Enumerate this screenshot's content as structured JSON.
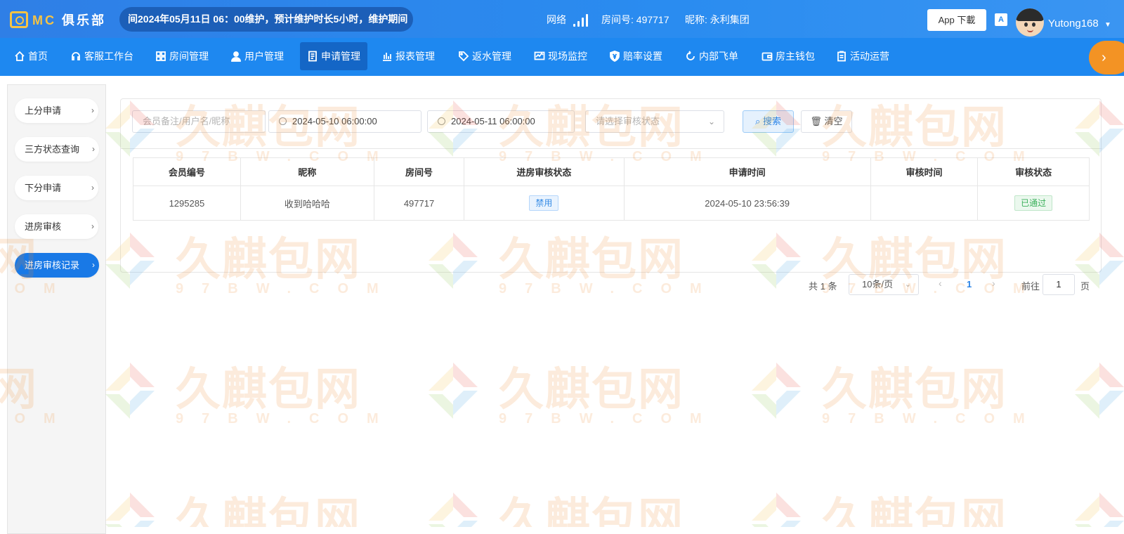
{
  "header": {
    "brand_prefix": "MC",
    "brand_cn": "俱乐部",
    "announcement": "间2024年05月11日 06：00维护，预计维护时长5小时，维护期间",
    "network_label": "网络",
    "room_label": "房间号: 497717",
    "nickname_label": "昵称: 永利集团",
    "app_download": "App 下載",
    "lang_icon": "translate-icon",
    "username": "Yutong168"
  },
  "nav": {
    "items": [
      {
        "label": "首页",
        "icon": "home-icon"
      },
      {
        "label": "客服工作台",
        "icon": "headset-icon"
      },
      {
        "label": "房间管理",
        "icon": "grid-icon"
      },
      {
        "label": "用户管理",
        "icon": "user-icon"
      },
      {
        "label": "申请管理",
        "icon": "form-icon"
      },
      {
        "label": "报表管理",
        "icon": "bar-chart-icon"
      },
      {
        "label": "返水管理",
        "icon": "tag-icon"
      },
      {
        "label": "现场监控",
        "icon": "monitor-icon"
      },
      {
        "label": "赔率设置",
        "icon": "yen-shield-icon"
      },
      {
        "label": "内部飞单",
        "icon": "cycle-icon"
      },
      {
        "label": "房主钱包",
        "icon": "wallet-icon"
      },
      {
        "label": "活动运营",
        "icon": "clipboard-icon"
      }
    ],
    "active_index": 4
  },
  "sidebar": {
    "items": [
      {
        "label": "上分申请"
      },
      {
        "label": "三方状态查询"
      },
      {
        "label": "下分申请"
      },
      {
        "label": "进房审核"
      },
      {
        "label": "进房审核记录"
      }
    ],
    "active_index": 4
  },
  "filters": {
    "search_placeholder": "会员备注/用户名/昵称",
    "start_time": "2024-05-10 06:00:00",
    "end_time": "2024-05-11 06:00:00",
    "status_placeholder": "请选择审核状态",
    "search_button": "搜索",
    "clear_button": "清空"
  },
  "table": {
    "columns": [
      "会员编号",
      "昵称",
      "房间号",
      "进房审核状态",
      "申请时间",
      "审核时间",
      "审核状态"
    ],
    "rows": [
      {
        "member_id": "1295285",
        "nickname": "收到哈哈哈",
        "room_no": "497717",
        "entry_status": "禁用",
        "apply_time": "2024-05-10 23:56:39",
        "review_time": "",
        "review_status": "已通过"
      }
    ]
  },
  "pagination": {
    "total": "共 1 条",
    "page_size": "10条/页",
    "current_page": "1",
    "goto_label": "前往",
    "goto_value": "1",
    "page_unit": "页"
  },
  "watermark": {
    "title": "久麒包网",
    "subtitle": "97BW.COM"
  },
  "colors": {
    "header_blue": "#2a8cf0",
    "nav_blue": "#1e88f0",
    "nav_active": "#1466c6",
    "accent_orange": "#f39324",
    "brand_gold": "#f6c344",
    "tag_green": "#3ab05a",
    "tag_blue": "#3a8ee6"
  }
}
